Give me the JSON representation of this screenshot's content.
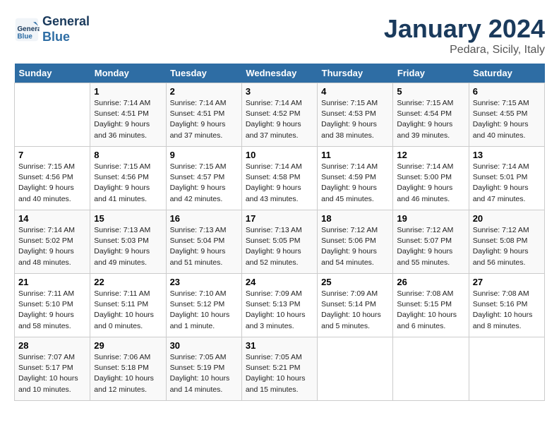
{
  "header": {
    "logo_line1": "General",
    "logo_line2": "Blue",
    "title": "January 2024",
    "subtitle": "Pedara, Sicily, Italy"
  },
  "days_of_week": [
    "Sunday",
    "Monday",
    "Tuesday",
    "Wednesday",
    "Thursday",
    "Friday",
    "Saturday"
  ],
  "weeks": [
    [
      {
        "num": "",
        "info": ""
      },
      {
        "num": "1",
        "info": "Sunrise: 7:14 AM\nSunset: 4:51 PM\nDaylight: 9 hours\nand 36 minutes."
      },
      {
        "num": "2",
        "info": "Sunrise: 7:14 AM\nSunset: 4:51 PM\nDaylight: 9 hours\nand 37 minutes."
      },
      {
        "num": "3",
        "info": "Sunrise: 7:14 AM\nSunset: 4:52 PM\nDaylight: 9 hours\nand 37 minutes."
      },
      {
        "num": "4",
        "info": "Sunrise: 7:15 AM\nSunset: 4:53 PM\nDaylight: 9 hours\nand 38 minutes."
      },
      {
        "num": "5",
        "info": "Sunrise: 7:15 AM\nSunset: 4:54 PM\nDaylight: 9 hours\nand 39 minutes."
      },
      {
        "num": "6",
        "info": "Sunrise: 7:15 AM\nSunset: 4:55 PM\nDaylight: 9 hours\nand 40 minutes."
      }
    ],
    [
      {
        "num": "7",
        "info": "Sunrise: 7:15 AM\nSunset: 4:56 PM\nDaylight: 9 hours\nand 40 minutes."
      },
      {
        "num": "8",
        "info": "Sunrise: 7:15 AM\nSunset: 4:56 PM\nDaylight: 9 hours\nand 41 minutes."
      },
      {
        "num": "9",
        "info": "Sunrise: 7:15 AM\nSunset: 4:57 PM\nDaylight: 9 hours\nand 42 minutes."
      },
      {
        "num": "10",
        "info": "Sunrise: 7:14 AM\nSunset: 4:58 PM\nDaylight: 9 hours\nand 43 minutes."
      },
      {
        "num": "11",
        "info": "Sunrise: 7:14 AM\nSunset: 4:59 PM\nDaylight: 9 hours\nand 45 minutes."
      },
      {
        "num": "12",
        "info": "Sunrise: 7:14 AM\nSunset: 5:00 PM\nDaylight: 9 hours\nand 46 minutes."
      },
      {
        "num": "13",
        "info": "Sunrise: 7:14 AM\nSunset: 5:01 PM\nDaylight: 9 hours\nand 47 minutes."
      }
    ],
    [
      {
        "num": "14",
        "info": "Sunrise: 7:14 AM\nSunset: 5:02 PM\nDaylight: 9 hours\nand 48 minutes."
      },
      {
        "num": "15",
        "info": "Sunrise: 7:13 AM\nSunset: 5:03 PM\nDaylight: 9 hours\nand 49 minutes."
      },
      {
        "num": "16",
        "info": "Sunrise: 7:13 AM\nSunset: 5:04 PM\nDaylight: 9 hours\nand 51 minutes."
      },
      {
        "num": "17",
        "info": "Sunrise: 7:13 AM\nSunset: 5:05 PM\nDaylight: 9 hours\nand 52 minutes."
      },
      {
        "num": "18",
        "info": "Sunrise: 7:12 AM\nSunset: 5:06 PM\nDaylight: 9 hours\nand 54 minutes."
      },
      {
        "num": "19",
        "info": "Sunrise: 7:12 AM\nSunset: 5:07 PM\nDaylight: 9 hours\nand 55 minutes."
      },
      {
        "num": "20",
        "info": "Sunrise: 7:12 AM\nSunset: 5:08 PM\nDaylight: 9 hours\nand 56 minutes."
      }
    ],
    [
      {
        "num": "21",
        "info": "Sunrise: 7:11 AM\nSunset: 5:10 PM\nDaylight: 9 hours\nand 58 minutes."
      },
      {
        "num": "22",
        "info": "Sunrise: 7:11 AM\nSunset: 5:11 PM\nDaylight: 10 hours\nand 0 minutes."
      },
      {
        "num": "23",
        "info": "Sunrise: 7:10 AM\nSunset: 5:12 PM\nDaylight: 10 hours\nand 1 minute."
      },
      {
        "num": "24",
        "info": "Sunrise: 7:09 AM\nSunset: 5:13 PM\nDaylight: 10 hours\nand 3 minutes."
      },
      {
        "num": "25",
        "info": "Sunrise: 7:09 AM\nSunset: 5:14 PM\nDaylight: 10 hours\nand 5 minutes."
      },
      {
        "num": "26",
        "info": "Sunrise: 7:08 AM\nSunset: 5:15 PM\nDaylight: 10 hours\nand 6 minutes."
      },
      {
        "num": "27",
        "info": "Sunrise: 7:08 AM\nSunset: 5:16 PM\nDaylight: 10 hours\nand 8 minutes."
      }
    ],
    [
      {
        "num": "28",
        "info": "Sunrise: 7:07 AM\nSunset: 5:17 PM\nDaylight: 10 hours\nand 10 minutes."
      },
      {
        "num": "29",
        "info": "Sunrise: 7:06 AM\nSunset: 5:18 PM\nDaylight: 10 hours\nand 12 minutes."
      },
      {
        "num": "30",
        "info": "Sunrise: 7:05 AM\nSunset: 5:19 PM\nDaylight: 10 hours\nand 14 minutes."
      },
      {
        "num": "31",
        "info": "Sunrise: 7:05 AM\nSunset: 5:21 PM\nDaylight: 10 hours\nand 15 minutes."
      },
      {
        "num": "",
        "info": ""
      },
      {
        "num": "",
        "info": ""
      },
      {
        "num": "",
        "info": ""
      }
    ]
  ]
}
